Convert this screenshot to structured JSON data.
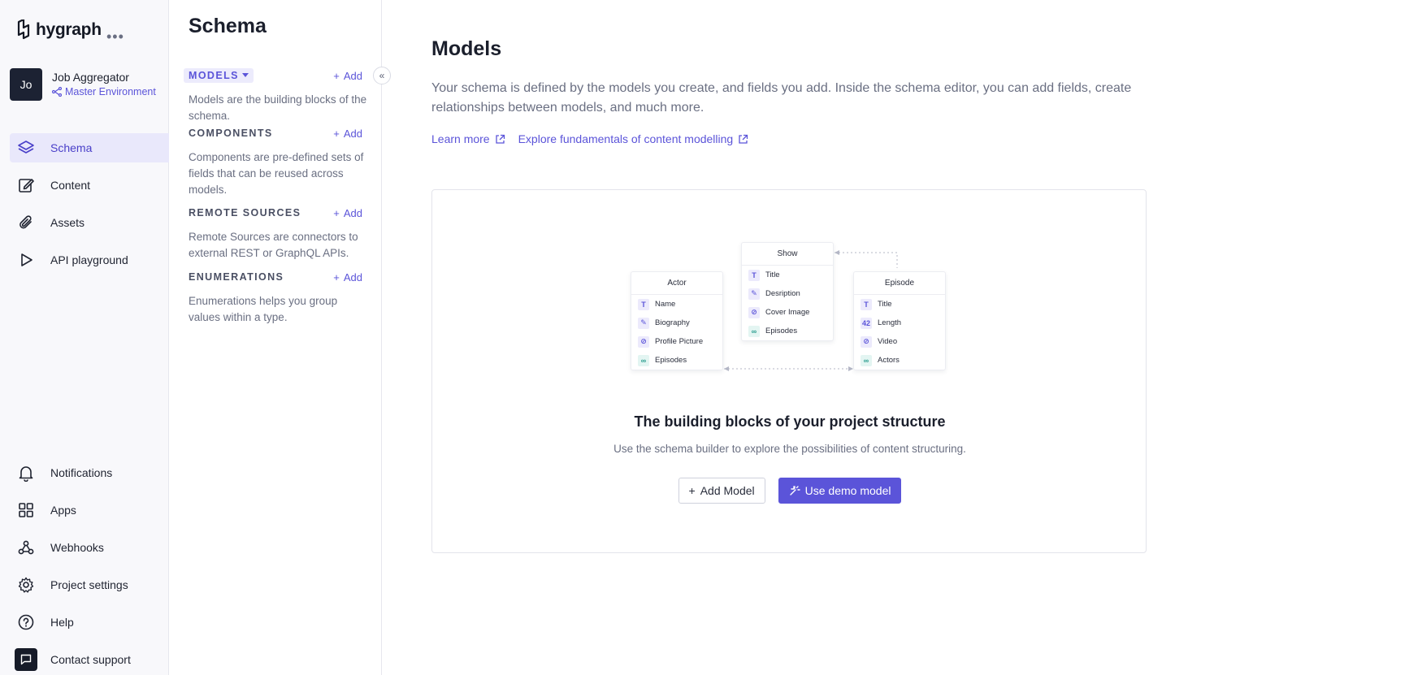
{
  "brand": {
    "name": "hygraph",
    "more": "•••"
  },
  "project": {
    "initials": "Jo",
    "name": "Job Aggregator",
    "environment": "Master Environment"
  },
  "nav": {
    "items": [
      {
        "label": "Schema",
        "icon": "layers-icon",
        "active": true
      },
      {
        "label": "Content",
        "icon": "edit-icon"
      },
      {
        "label": "Assets",
        "icon": "paperclip-icon"
      },
      {
        "label": "API playground",
        "icon": "play-icon"
      }
    ],
    "bottom": [
      {
        "label": "Notifications",
        "icon": "bell-icon"
      },
      {
        "label": "Apps",
        "icon": "apps-grid-icon"
      },
      {
        "label": "Webhooks",
        "icon": "webhook-icon"
      },
      {
        "label": "Project settings",
        "icon": "gear-icon"
      },
      {
        "label": "Help",
        "icon": "help-circle-icon"
      },
      {
        "label": "Contact support",
        "icon": "chat-icon"
      }
    ]
  },
  "schema_panel": {
    "title": "Schema",
    "sections": [
      {
        "label": "MODELS",
        "add": "Add",
        "description": "Models are the building blocks of the schema."
      },
      {
        "label": "COMPONENTS",
        "add": "Add",
        "description": "Components are pre-defined sets of fields that can be reused across models."
      },
      {
        "label": "REMOTE SOURCES",
        "add": "Add",
        "description": "Remote Sources are connectors to external REST or GraphQL APIs."
      },
      {
        "label": "ENUMERATIONS",
        "add": "Add",
        "description": "Enumerations helps you group values within a type."
      }
    ]
  },
  "main": {
    "title": "Models",
    "description": "Your schema is defined by the models you create, and fields you add. Inside the schema editor, you can add fields, create relationships between models, and much more.",
    "links": [
      "Learn more",
      "Explore fundamentals of content modelling"
    ],
    "card": {
      "diagram": {
        "actor": {
          "title": "Actor",
          "fields": [
            "Name",
            "Biography",
            "Profile Picture",
            "Episodes"
          ]
        },
        "show": {
          "title": "Show",
          "fields": [
            "Title",
            "Desription",
            "Cover Image",
            "Episodes"
          ]
        },
        "episode": {
          "title": "Episode",
          "fields": [
            "Title",
            "Length",
            "Video",
            "Actors"
          ]
        },
        "length_icon": "42",
        "text_icon": "T"
      },
      "title": "The building blocks of your project structure",
      "subtitle": "Use the schema builder to explore the possibilities of content structuring.",
      "add_model": "Add Model",
      "use_demo": "Use demo model"
    }
  },
  "colors": {
    "accent": "#5b54d9",
    "active_bg": "#e9e8fb",
    "help_dot": "#e6386f"
  }
}
